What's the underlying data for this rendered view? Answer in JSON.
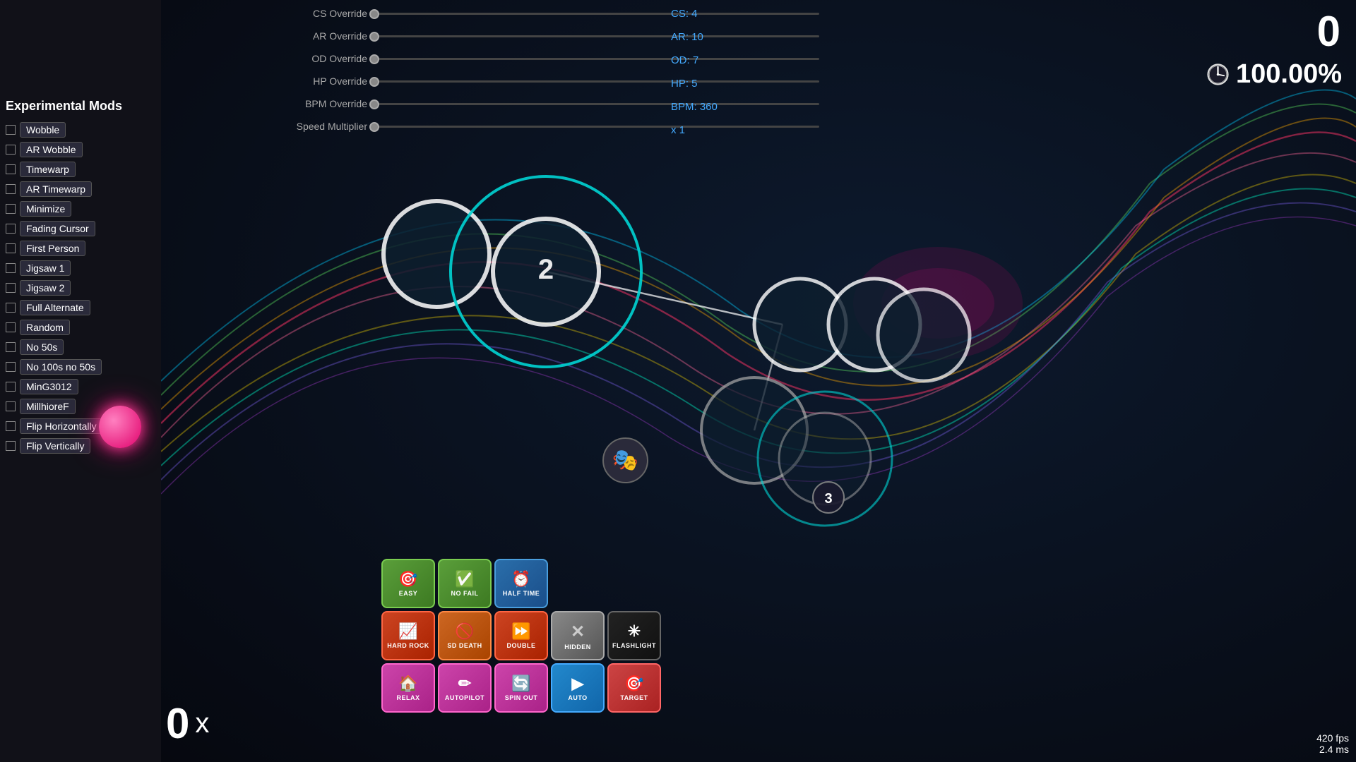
{
  "score": {
    "value": "0",
    "accuracy": "100.00%",
    "combo": "0",
    "combo_x": "x"
  },
  "fps": {
    "fps": "420 fps",
    "ms": "2.4 ms"
  },
  "stats": {
    "cs": "CS: 4",
    "ar": "AR: 10",
    "od": "OD: 7",
    "hp": "HP: 5",
    "bpm": "BPM: 360",
    "multiplier": "x 1"
  },
  "sliders": [
    {
      "label": "CS Override"
    },
    {
      "label": "AR Override"
    },
    {
      "label": "OD Override"
    },
    {
      "label": "HP Override"
    },
    {
      "label": "BPM Override"
    },
    {
      "label": "Speed Multiplier"
    }
  ],
  "experimental_title": "Experimental Mods",
  "mods": [
    {
      "id": "wobble",
      "label": "Wobble"
    },
    {
      "id": "ar-wobble",
      "label": "AR Wobble"
    },
    {
      "id": "timewarp",
      "label": "Timewarp"
    },
    {
      "id": "ar-timewarp",
      "label": "AR Timewarp"
    },
    {
      "id": "minimize",
      "label": "Minimize"
    },
    {
      "id": "fading-cursor",
      "label": "Fading Cursor"
    },
    {
      "id": "first-person",
      "label": "First Person"
    },
    {
      "id": "jigsaw-1",
      "label": "Jigsaw 1"
    },
    {
      "id": "jigsaw-2",
      "label": "Jigsaw 2"
    },
    {
      "id": "full-alternate",
      "label": "Full Alternate"
    },
    {
      "id": "random",
      "label": "Random"
    },
    {
      "id": "no-50s",
      "label": "No 50s"
    },
    {
      "id": "no-100s-no-50s",
      "label": "No 100s no 50s"
    },
    {
      "id": "ming3012",
      "label": "MinG3012"
    },
    {
      "id": "millhioref",
      "label": "MillhioreF"
    },
    {
      "id": "flip-horizontally",
      "label": "Flip Horizontally"
    },
    {
      "id": "flip-vertically",
      "label": "Flip Vertically"
    }
  ],
  "mod_buttons": {
    "row1": [
      {
        "id": "easy",
        "label": "EASY",
        "class": "btn-easy",
        "icon": "🎯"
      },
      {
        "id": "nofail",
        "label": "NO FAIL",
        "class": "btn-nofail",
        "icon": "✅"
      },
      {
        "id": "halftime",
        "label": "HALF TIME",
        "class": "btn-halftime",
        "icon": "⏰"
      }
    ],
    "row2": [
      {
        "id": "hardrock",
        "label": "HARD ROCK",
        "class": "btn-hardrock",
        "icon": "📈"
      },
      {
        "id": "suddendeath",
        "label": "SD DEATH",
        "class": "btn-suddendeath",
        "icon": "🚫"
      },
      {
        "id": "double",
        "label": "DOUBLE",
        "class": "btn-double",
        "icon": "⏩"
      },
      {
        "id": "hidden",
        "label": "HIDDEN",
        "class": "btn-hidden",
        "icon": "✕"
      },
      {
        "id": "flashlight",
        "label": "FLASHLIGHT",
        "class": "btn-flashlight",
        "icon": "✳"
      }
    ],
    "row3": [
      {
        "id": "relax",
        "label": "RELAX",
        "class": "btn-relax",
        "icon": "🏠"
      },
      {
        "id": "autopilot",
        "label": "AUTOPILOT",
        "class": "btn-autopilot",
        "icon": "✏"
      },
      {
        "id": "spinout",
        "label": "SPIN OUT",
        "class": "btn-spinout",
        "icon": "🔄"
      },
      {
        "id": "auto",
        "label": "AUTO",
        "class": "btn-auto",
        "icon": "▶"
      },
      {
        "id": "target",
        "label": "TARGET",
        "class": "btn-target",
        "icon": "🎯"
      }
    ]
  }
}
